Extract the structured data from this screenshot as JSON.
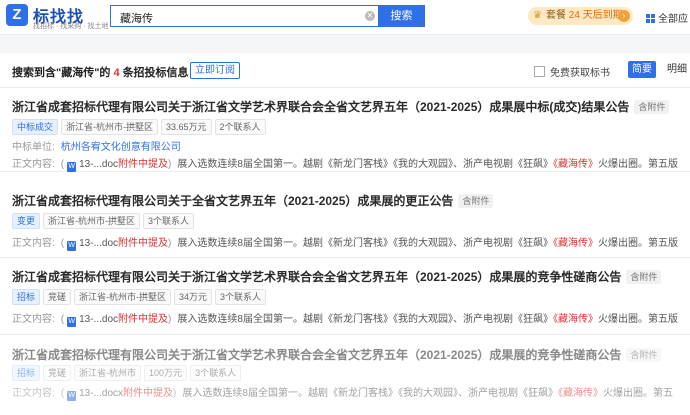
{
  "header": {
    "logo_letter": "Z",
    "logo_name": "标找找",
    "logo_slogan": "找招标 · 找采购 · 找土地",
    "search_value": "藏海传",
    "search_button": "搜索",
    "vip_prefix": "套餐 ",
    "vip_highlight": "24 天后到期",
    "all_apps": "全部应"
  },
  "summary": {
    "prefix": "搜索到含\"",
    "keyword": "藏海传",
    "mid": "\"的",
    "count": "4",
    "suffix": "条招投标信息",
    "subscribe": "立即订阅",
    "free_get": "免费获取标书",
    "mode_summary": "简要",
    "mode_detail": "明细"
  },
  "results": [
    {
      "title": "浙江省成套招标代理有限公司关于浙江省文学艺术界联合会全省文艺界五年（2021-2025）成果展中标(成交)结果公告",
      "attachment_tag": "含附件",
      "tags": [
        "中标成交",
        "浙江省-杭州市-拱墅区",
        "33.65万元",
        "2个联系人"
      ],
      "winner_label": "中标单位:",
      "winner": "杭州各宥文化创意有限公司",
      "body_label": "正文内容:",
      "file_name": "13-...doc",
      "file_attach": "附件中提及",
      "snippet_pre": "展入选数连续8届全国第一。越剧《新龙门客栈》《我的大观园》、浙产电视剧《狂飙》",
      "snippet_hl": "《藏海传》",
      "snippet_post": "火爆出圈。第五版"
    },
    {
      "title": "浙江省成套招标代理有限公司关于全省文艺界五年（2021-2025）成果展的更正公告",
      "attachment_tag": "含附件",
      "tags": [
        "变更",
        "浙江省-杭州市-拱墅区",
        "3个联系人"
      ],
      "body_label": "正文内容:",
      "file_name": "13-...doc",
      "file_attach": "附件中提及",
      "snippet_pre": "展入选数连续8届全国第一。越剧《新龙门客栈》《我的大观园》、浙产电视剧《狂飙》",
      "snippet_hl": "《藏海传》",
      "snippet_post": "火爆出圈。第五版"
    },
    {
      "title": "浙江省成套招标代理有限公司关于浙江省文学艺术界联合会全省文艺界五年（2021-2025）成果展的竞争性磋商公告",
      "attachment_tag": "含附件",
      "tags": [
        "招标",
        "竞磋",
        "浙江省-杭州市-拱墅区",
        "34万元",
        "3个联系人"
      ],
      "body_label": "正文内容:",
      "file_name": "13-...doc",
      "file_attach": "附件中提及",
      "snippet_pre": "展入选数连续8届全国第一。越剧《新龙门客栈》《我的大观园》、浙产电视剧《狂飙》",
      "snippet_hl": "《藏海传》",
      "snippet_post": "火爆出圈。第五版"
    },
    {
      "title": "浙江省成套招标代理有限公司关于浙江省文学艺术界联合会全省文艺界五年（2021-2025）成果展的竞争性磋商公告",
      "attachment_tag": "含附件",
      "tags": [
        "招标",
        "竞磋",
        "浙江省-杭州市",
        "100万元",
        "3个联系人"
      ],
      "body_label": "正文内容:",
      "file_name": "13-...docx",
      "file_attach": "附件中提及",
      "snippet_pre": "展入选数连续8届全国第一。越剧《新龙门客栈》《我的大观园》、浙产电视剧《狂飙》",
      "snippet_hl": "《藏海传》",
      "snippet_post": "火爆出圈。第五"
    }
  ]
}
